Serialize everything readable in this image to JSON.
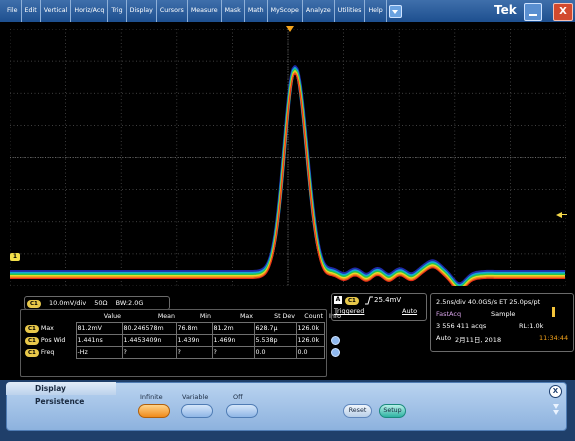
{
  "menu": {
    "items": [
      "File",
      "Edit",
      "Vertical",
      "Horiz/Acq",
      "Trig",
      "Display",
      "Cursors",
      "Measure",
      "Mask",
      "Math",
      "MyScope",
      "Analyze",
      "Utilities",
      "Help"
    ],
    "brand": "Tek",
    "close_label": "X"
  },
  "scope": {
    "ground_marker": "1",
    "waveform_color_ramp": [
      "#1e2aa8",
      "#15a7d8",
      "#25c84a",
      "#e8d82a",
      "#f08a1a",
      "#e8301a"
    ]
  },
  "channel": {
    "badge": "C1",
    "scale": "10.0mV/div",
    "impedance": "50Ω",
    "bandwidth": "BW:2.0G"
  },
  "measurements": {
    "headers": [
      "Value",
      "Mean",
      "Min",
      "Max",
      "St Dev",
      "Count",
      "Info"
    ],
    "rows": [
      {
        "badge": "C1",
        "name": "Max",
        "value": "81.2mV",
        "mean": "80.246578m",
        "min": "76.8m",
        "max": "81.2m",
        "stdev": "628.7μ",
        "count": "126.0k",
        "info": ""
      },
      {
        "badge": "C1",
        "name": "Pos Wid",
        "value": "1.441ns",
        "mean": "1.4453409n",
        "min": "1.439n",
        "max": "1.469n",
        "stdev": "5.538p",
        "count": "126.0k",
        "info": "dot"
      },
      {
        "badge": "C1",
        "name": "Freq",
        "value": "-Hz",
        "mean": "?",
        "min": "?",
        "max": "?",
        "stdev": "0.0",
        "count": "0.0",
        "info": "dot"
      }
    ]
  },
  "trigger": {
    "label": "A",
    "channel": "C1",
    "level": "25.4mV",
    "status": "Triggered",
    "mode": "Auto"
  },
  "acquisition": {
    "horizontal": "2.5ns/div   40.0GS/s  ET  25.0ps/pt",
    "fastacq": "FastAcq",
    "sample": "Sample",
    "count": "3 556 411 acqs",
    "record_length": "RL:1.0k",
    "mode": "Auto",
    "date": "2月11日, 2018",
    "time": "11:34:44"
  },
  "display_persistence": {
    "title": "Display Persistence",
    "options": [
      "Infinite",
      "Variable",
      "Off"
    ],
    "selected": "Infinite",
    "reset_label": "Reset",
    "setup_label": "Setup",
    "close_label": "X"
  }
}
